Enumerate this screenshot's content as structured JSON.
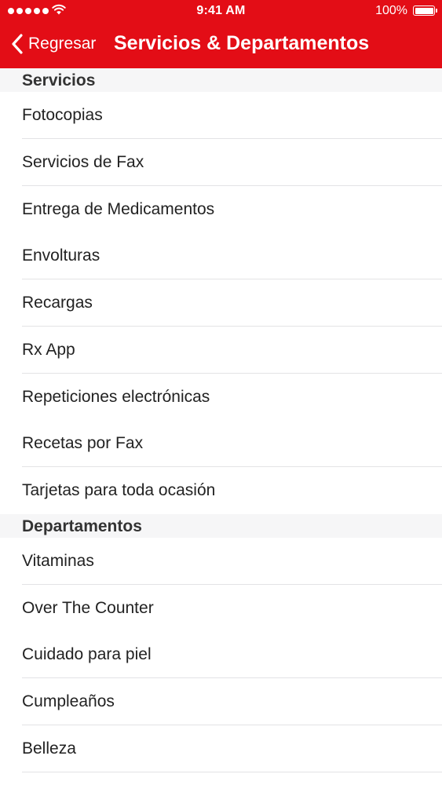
{
  "status_bar": {
    "time": "9:41 AM",
    "battery_percent": "100%",
    "battery_level": 1.0,
    "signal_icon": "signal-dots-icon",
    "wifi_icon": "wifi-icon"
  },
  "nav": {
    "back_label": "Regresar",
    "back_icon": "chevron-left-icon",
    "title": "Servicios & Departamentos"
  },
  "colors": {
    "nav_background": "#e30d16",
    "section_background": "#f6f6f7",
    "separator": "#e3e3e5"
  },
  "sections": [
    {
      "header": "Servicios",
      "items": [
        "Fotocopias",
        "Servicios de Fax",
        "Entrega de Medicamentos",
        "Envolturas",
        "Recargas",
        "Rx App",
        "Repeticiones electrónicas",
        "Recetas por Fax",
        "Tarjetas para toda ocasión"
      ]
    },
    {
      "header": "Departamentos",
      "items": [
        "Vitaminas",
        "Over The Counter",
        "Cuidado para piel",
        "Cumpleaños",
        "Belleza"
      ]
    }
  ]
}
